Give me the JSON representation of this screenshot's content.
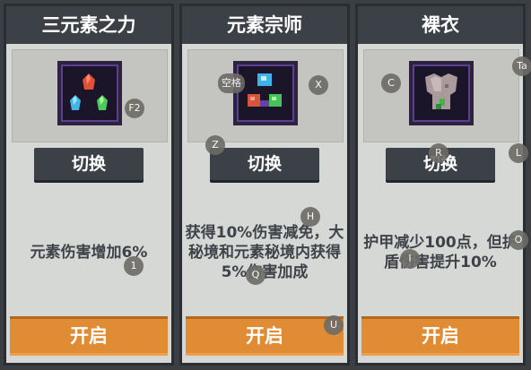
{
  "cards": [
    {
      "title": "三元素之力",
      "switch_label": "切换",
      "description": "元素伤害增加6%",
      "open_label": "开启",
      "icon": "three-element-gems-icon"
    },
    {
      "title": "元素宗师",
      "switch_label": "切换",
      "description": "获得10%伤害减免，大秘境和元素秘境内获得5%伤害加成",
      "open_label": "开启",
      "icon": "four-element-gems-icon"
    },
    {
      "title": "裸衣",
      "switch_label": "切换",
      "description": "护甲减少100点，但护盾伤害提升10%",
      "open_label": "开启",
      "icon": "broken-armor-icon"
    }
  ],
  "hotkeys": {
    "f2": "F2",
    "space": "空格",
    "x": "X",
    "c": "C",
    "tab": "Ta",
    "z": "Z",
    "r": "R",
    "l": "L",
    "h": "H",
    "o": "O",
    "one": "1",
    "i": "I",
    "q": "Q",
    "u": "U"
  },
  "colors": {
    "title_bar": "#3c4148",
    "card_bg": "#d6d8d5",
    "open_button": "#df8c35",
    "text": "#3d4348"
  }
}
